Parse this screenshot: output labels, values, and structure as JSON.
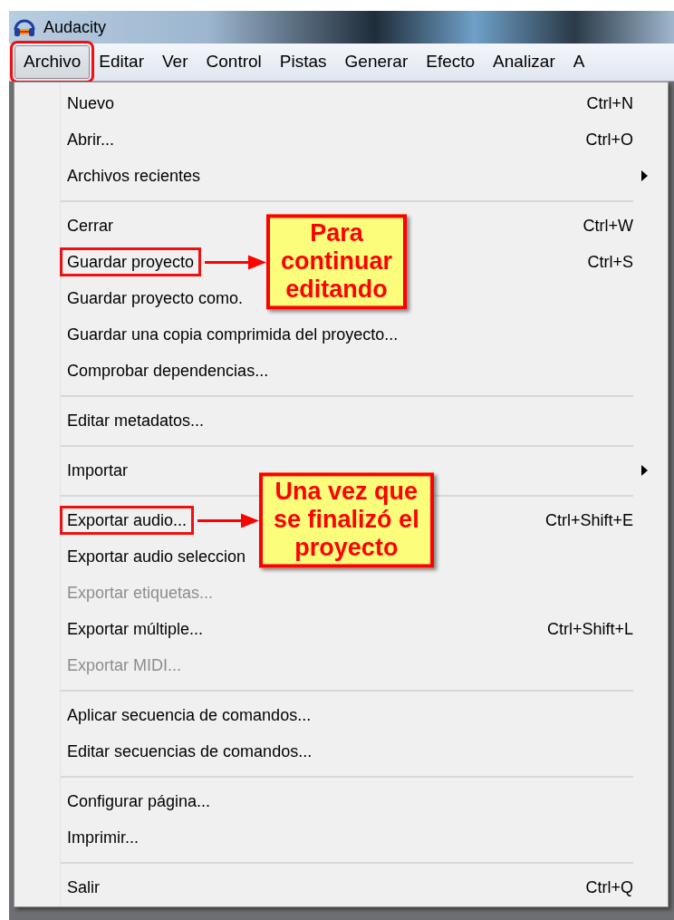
{
  "window": {
    "title": "Audacity"
  },
  "menubar": [
    {
      "label": "Archivo",
      "selected": true,
      "highlighted": true
    },
    {
      "label": "Editar",
      "selected": false,
      "highlighted": false
    },
    {
      "label": "Ver",
      "selected": false,
      "highlighted": false
    },
    {
      "label": "Control",
      "selected": false,
      "highlighted": false
    },
    {
      "label": "Pistas",
      "selected": false,
      "highlighted": false
    },
    {
      "label": "Generar",
      "selected": false,
      "highlighted": false
    },
    {
      "label": "Efecto",
      "selected": false,
      "highlighted": false
    },
    {
      "label": "Analizar",
      "selected": false,
      "highlighted": false
    },
    {
      "label": "A",
      "selected": false,
      "highlighted": false
    }
  ],
  "menu": {
    "items": [
      {
        "kind": "item",
        "label": "Nuevo",
        "shortcut": "Ctrl+N",
        "disabled": false,
        "highlighted": false
      },
      {
        "kind": "item",
        "label": "Abrir...",
        "shortcut": "Ctrl+O",
        "disabled": false,
        "highlighted": false
      },
      {
        "kind": "submenu",
        "label": "Archivos recientes",
        "disabled": false,
        "highlighted": false
      },
      {
        "kind": "separator"
      },
      {
        "kind": "item",
        "label": "Cerrar",
        "shortcut": "Ctrl+W",
        "disabled": false,
        "highlighted": false
      },
      {
        "kind": "item",
        "label": "Guardar proyecto",
        "shortcut": "Ctrl+S",
        "disabled": false,
        "highlighted": true,
        "callout": {
          "lines": [
            "Para",
            "continuar",
            "editando"
          ]
        }
      },
      {
        "kind": "item",
        "label": "Guardar proyecto como.",
        "disabled": false,
        "highlighted": false
      },
      {
        "kind": "item",
        "label": "Guardar una copia comprimida del proyecto...",
        "disabled": false,
        "highlighted": false
      },
      {
        "kind": "item",
        "label": "Comprobar dependencias...",
        "disabled": false,
        "highlighted": false
      },
      {
        "kind": "separator"
      },
      {
        "kind": "item",
        "label": "Editar metadatos...",
        "disabled": false,
        "highlighted": false
      },
      {
        "kind": "separator"
      },
      {
        "kind": "submenu",
        "label": "Importar",
        "disabled": false,
        "highlighted": false
      },
      {
        "kind": "separator"
      },
      {
        "kind": "item",
        "label": "Exportar audio...",
        "shortcut": "Ctrl+Shift+E",
        "disabled": false,
        "highlighted": true,
        "callout": {
          "lines": [
            "Una vez que",
            "se finalizó el",
            "proyecto"
          ]
        }
      },
      {
        "kind": "item",
        "label": "Exportar audio seleccion",
        "disabled": false,
        "highlighted": false
      },
      {
        "kind": "item",
        "label": "Exportar etiquetas...",
        "disabled": true,
        "highlighted": false
      },
      {
        "kind": "item",
        "label": "Exportar múltiple...",
        "shortcut": "Ctrl+Shift+L",
        "disabled": false,
        "highlighted": false
      },
      {
        "kind": "item",
        "label": "Exportar MIDI...",
        "disabled": true,
        "highlighted": false
      },
      {
        "kind": "separator"
      },
      {
        "kind": "item",
        "label": "Aplicar secuencia de comandos...",
        "disabled": false,
        "highlighted": false
      },
      {
        "kind": "item",
        "label": "Editar secuencias de comandos...",
        "disabled": false,
        "highlighted": false
      },
      {
        "kind": "separator"
      },
      {
        "kind": "item",
        "label": "Configurar página...",
        "disabled": false,
        "highlighted": false
      },
      {
        "kind": "item",
        "label": "Imprimir...",
        "disabled": false,
        "highlighted": false
      },
      {
        "kind": "separator"
      },
      {
        "kind": "item",
        "label": "Salir",
        "shortcut": "Ctrl+Q",
        "disabled": false,
        "highlighted": false
      }
    ]
  }
}
